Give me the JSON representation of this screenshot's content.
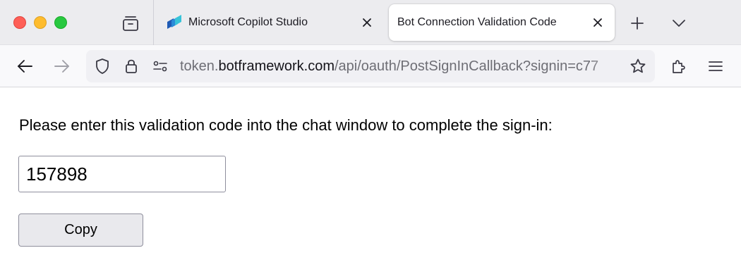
{
  "window": {
    "controls": [
      "close",
      "minimize",
      "maximize"
    ],
    "colors": {
      "close": "#fe5f57",
      "minimize": "#febc2e",
      "maximize": "#28c840"
    }
  },
  "tabs": [
    {
      "title": "Microsoft Copilot Studio",
      "icon": "copilot-studio-icon",
      "active": false
    },
    {
      "title": "Bot Connection Validation Code",
      "active": true
    }
  ],
  "urlbar": {
    "prefix": "token.",
    "domain": "botframework.com",
    "path": "/api/oauth/PostSignInCallback?signin=c77"
  },
  "page": {
    "instruction": "Please enter this validation code into the chat window to complete the sign-in:",
    "code": "157898",
    "copy_label": "Copy"
  }
}
